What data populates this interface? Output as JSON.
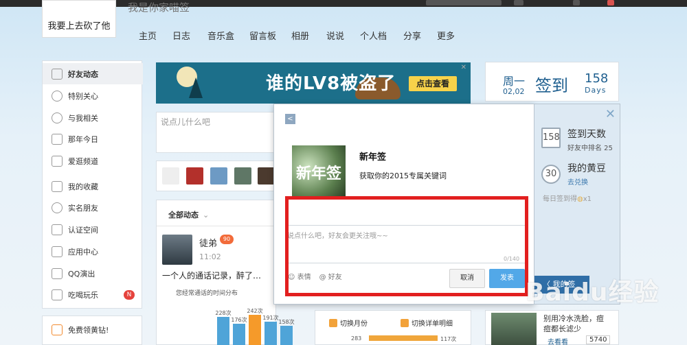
{
  "profile": {
    "caption": "我要上去砍了他",
    "nickname_partial": "我是你家喵签"
  },
  "nav": [
    "主页",
    "日志",
    "音乐盒",
    "留言板",
    "相册",
    "说说",
    "个人档",
    "分享",
    "更多"
  ],
  "left_menu": [
    {
      "label": "好友动态",
      "icon": "friends-icon",
      "active": true
    },
    {
      "label": "特别关心",
      "icon": "heart-icon"
    },
    {
      "label": "与我相关",
      "icon": "at-icon"
    },
    {
      "label": "那年今日",
      "icon": "calendar-icon"
    },
    {
      "label": "爱逛频道",
      "icon": "camera-icon"
    },
    {
      "label": "我的收藏",
      "icon": "star-icon"
    },
    {
      "label": "实名朋友",
      "icon": "globe-icon"
    },
    {
      "label": "认证空间",
      "icon": "badge-icon"
    },
    {
      "label": "应用中心",
      "icon": "apps-icon"
    },
    {
      "label": "QQ演出",
      "icon": "ticket-icon"
    },
    {
      "label": "吃喝玩乐",
      "icon": "food-icon",
      "badge": "N"
    }
  ],
  "left_bottom": {
    "label": "免费领黄钻!",
    "icon": "diamond-icon"
  },
  "banner": {
    "text": "谁的LV8被盗了",
    "button": "点击查看"
  },
  "post_box": {
    "placeholder": "说点儿什么吧"
  },
  "feed": {
    "header": "全部动态",
    "user": "徒弟",
    "time": "11:02",
    "text": "一个人的通话记录，醉了…",
    "chart_title": "您经常通话的时间分布"
  },
  "chart_data": {
    "type": "bar",
    "title": "您经常通话的时间分布",
    "categories": [
      "",
      "",
      "",
      "",
      ""
    ],
    "values": [
      228,
      176,
      242,
      191,
      158
    ],
    "value_labels": [
      "228次",
      "176次",
      "242次",
      "191次",
      "158次"
    ],
    "highlight_index": 2,
    "colors": {
      "normal": "#4fa4d8",
      "highlight": "#f59a2a"
    }
  },
  "mid_strip": {
    "left": "切换月份",
    "right": "切换详单明细",
    "count_left": "283",
    "count_right": "117次"
  },
  "checkin_card": {
    "weekday": "周一",
    "date": "02,02",
    "label": "签到",
    "days": "158",
    "days_label": "Days"
  },
  "popup": {
    "title": "新年签",
    "thumb_text": "新年签",
    "desc": "获取你的2015专属关键词",
    "placeholder": "说点什么吧，好友会更关注哦~~",
    "counter": "0/140",
    "emoji_label": "表情",
    "friend_label": "@ 好友",
    "cancel": "取消",
    "publish": "发表"
  },
  "right_panel": {
    "checkin_days_title": "签到天数",
    "checkin_days_value": "158",
    "checkin_rank": "好友中排名 25",
    "beans_title": "我的黄豆",
    "beans_value": "30",
    "beans_link": "去兑换",
    "daily": "每日签到得",
    "daily_bonus": "x1",
    "my_checkin": "〈 我的签"
  },
  "right_user": {
    "text": "别用冷水洗脸，痘痘都长滤少",
    "look": "去看看",
    "count": "5740"
  },
  "watermark": "Baidu经验"
}
